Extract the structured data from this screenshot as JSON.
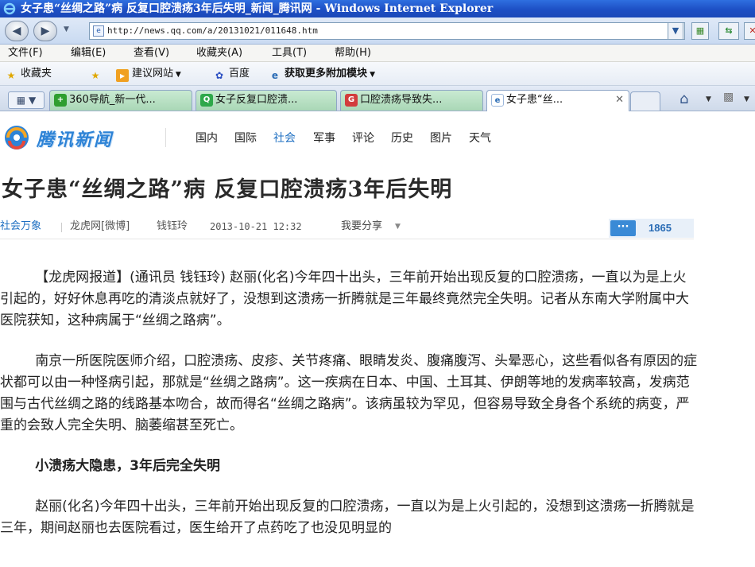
{
  "window": {
    "title": "女子患“丝绸之路”病 反复口腔溃疡3年后失明_新闻_腾讯网 - Windows Internet Explorer"
  },
  "address": {
    "url": "http://news.qq.com/a/20131021/011648.htm"
  },
  "menu": {
    "items": [
      "文件(F)",
      "编辑(E)",
      "查看(V)",
      "收藏夹(A)",
      "工具(T)",
      "帮助(H)"
    ]
  },
  "favorites": {
    "label": "收藏夹",
    "items": [
      "建议网站",
      "百度",
      "获取更多附加模块"
    ]
  },
  "tabs": [
    "360导航_新一代...",
    "女子反复口腔溃...",
    "口腔溃疡导致失...",
    "女子患“丝..."
  ],
  "site": {
    "logo_text": "腾讯新闻",
    "nav": [
      "国内",
      "国际",
      "社会",
      "军事",
      "评论",
      "历史",
      "图片",
      "天气"
    ]
  },
  "article": {
    "headline": "女子患“丝绸之路”病 反复口腔溃疡3年后失明",
    "category": "社会万象",
    "source": "龙虎网[微博]",
    "author": "钱钰玲",
    "time": "2013-10-21 12:32",
    "share": "我要分享",
    "comment_count": "1865",
    "p1": "【龙虎网报道】(通讯员 钱钰玲) 赵丽(化名)今年四十出头，三年前开始出现反复的口腔溃疡，一直以为是上火引起的，好好休息再吃的清淡点就好了，没想到这溃疡一折腾就是三年最终竟然完全失明。记者从东南大学附属中大医院获知，这种病属于“丝绸之路病”。",
    "p2": "南京一所医院医师介绍，口腔溃疡、皮疹、关节疼痛、眼睛发炎、腹痛腹泻、头晕恶心，这些看似各有原因的症状都可以由一种怪病引起，那就是“丝绸之路病”。这一疾病在日本、中国、土耳其、伊朗等地的发病率较高，发病范围与古代丝绸之路的线路基本吻合，故而得名“丝绸之路病”。该病虽较为罕见，但容易导致全身各个系统的病变，严重的会致人完全失明、脑萎缩甚至死亡。",
    "subhead": "小溃疡大隐患，3年后完全失明",
    "p3": "赵丽(化名)今年四十出头，三年前开始出现反复的口腔溃疡，一直以为是上火引起的，没想到这溃疡一折腾就是三年，期间赵丽也去医院看过，医生给开了点药吃了也没见明显的"
  }
}
